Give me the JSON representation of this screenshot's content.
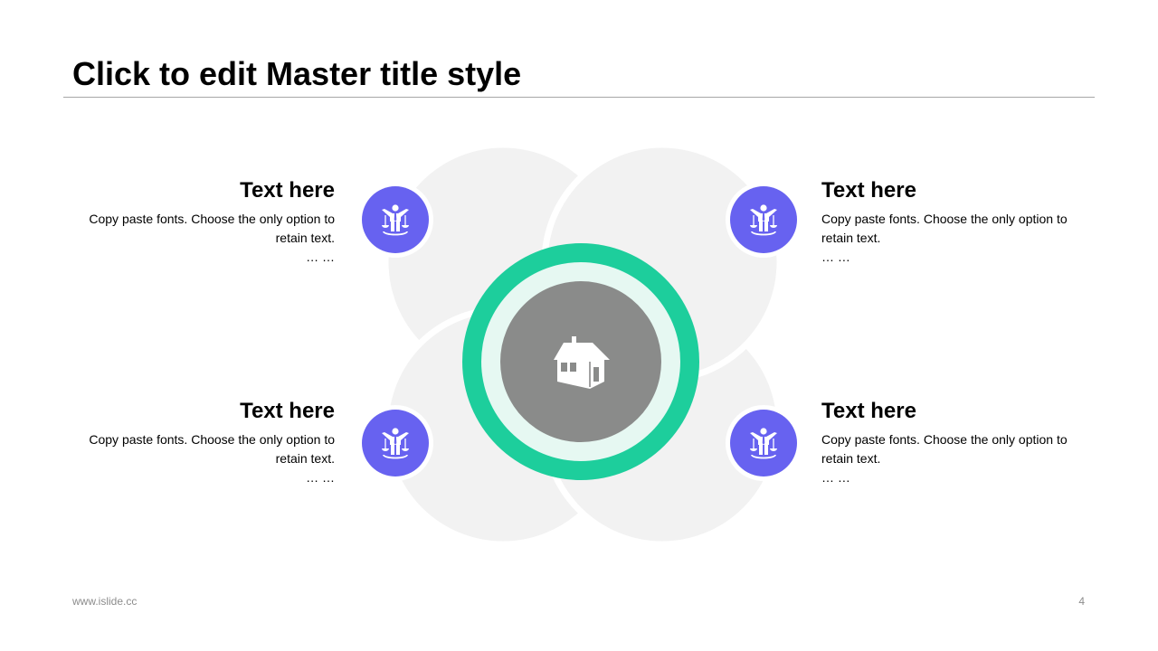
{
  "slide": {
    "title": "Click to edit Master title style"
  },
  "colors": {
    "accent_purple": "#6762f0",
    "accent_green": "#1dce9c",
    "inner_ring": "#e6f8f2",
    "center_gray": "#8a8b8a",
    "petal_gray": "#f2f2f2"
  },
  "center": {
    "icon": "house-icon"
  },
  "items": [
    {
      "title": "Text here",
      "description": "Copy paste fonts. Choose the only option to retain text.",
      "more": "… …",
      "icon": "justice-person-scales-icon"
    },
    {
      "title": "Text here",
      "description": "Copy paste fonts. Choose the only option to retain text.",
      "more": "… …",
      "icon": "justice-person-scales-icon"
    },
    {
      "title": "Text here",
      "description": "Copy paste fonts. Choose the only option to retain text.",
      "more": "… …",
      "icon": "justice-person-scales-icon"
    },
    {
      "title": "Text here",
      "description": "Copy paste fonts. Choose the only option to retain text.",
      "more": "… …",
      "icon": "justice-person-scales-icon"
    }
  ],
  "footer": {
    "url": "www.islide.cc",
    "page_number": "4"
  }
}
